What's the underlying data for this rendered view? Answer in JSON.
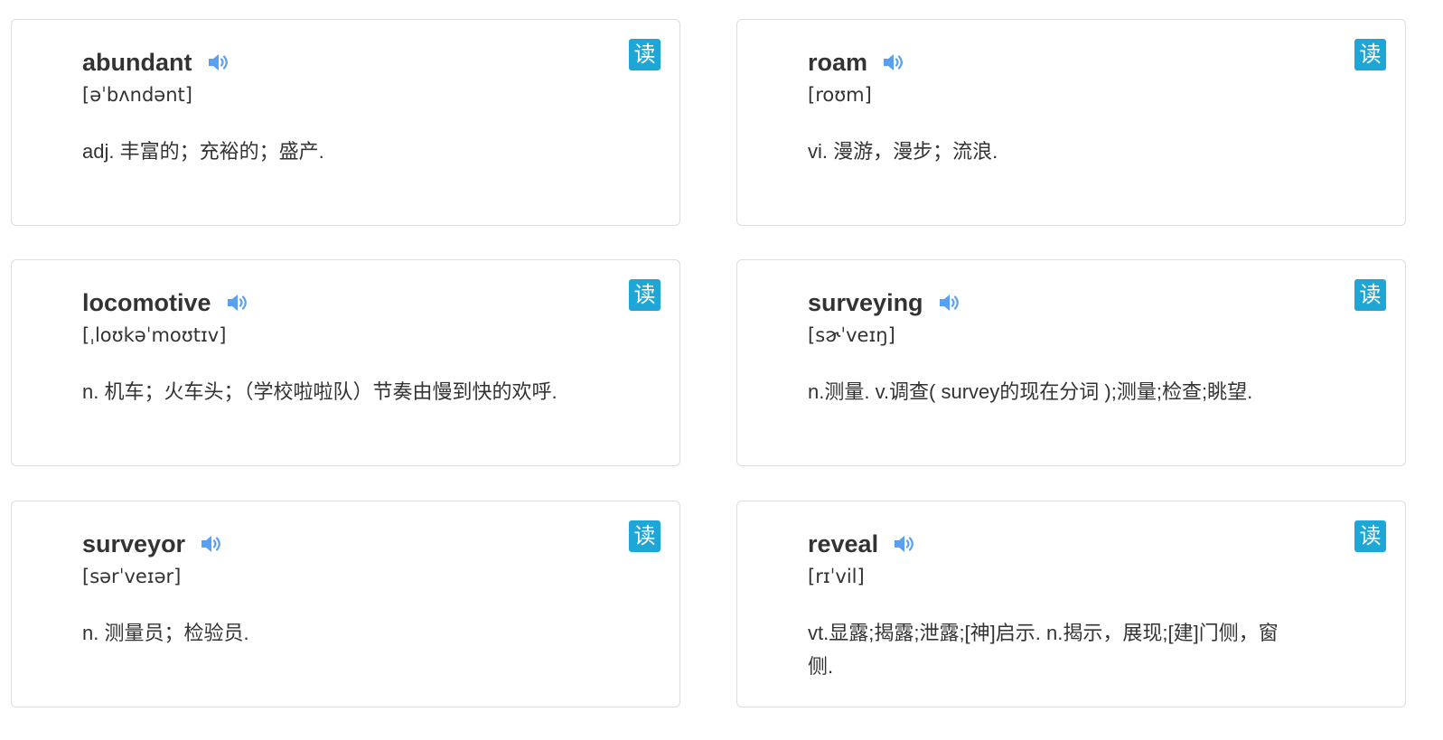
{
  "read_label": "读",
  "accent_color": "#1ea7d6",
  "speaker_color": "#5aa0f0",
  "speaker_icon": "speaker-icon",
  "cards": [
    {
      "word": "abundant",
      "phonetic": "[əˈbʌndənt]",
      "definition": "adj. 丰富的；充裕的；盛产."
    },
    {
      "word": "roam",
      "phonetic": "[roʊm]",
      "definition": "vi. 漫游，漫步；流浪."
    },
    {
      "word": "locomotive",
      "phonetic": "[ˌloʊkəˈmoʊtɪv]",
      "definition": "n. 机车；火车头；（学校啦啦队）节奏由慢到快的欢呼."
    },
    {
      "word": "surveying",
      "phonetic": "[sɚˈveɪŋ]",
      "definition": "n.测量. v.调查( survey的现在分词 );测量;检查;眺望."
    },
    {
      "word": "surveyor",
      "phonetic": "[sərˈveɪər]",
      "definition": "n. 测量员；检验员."
    },
    {
      "word": "reveal",
      "phonetic": "[rɪˈvil]",
      "definition": "vt.显露;揭露;泄露;[神]启示. n.揭示，展现;[建]门侧，窗侧."
    }
  ]
}
